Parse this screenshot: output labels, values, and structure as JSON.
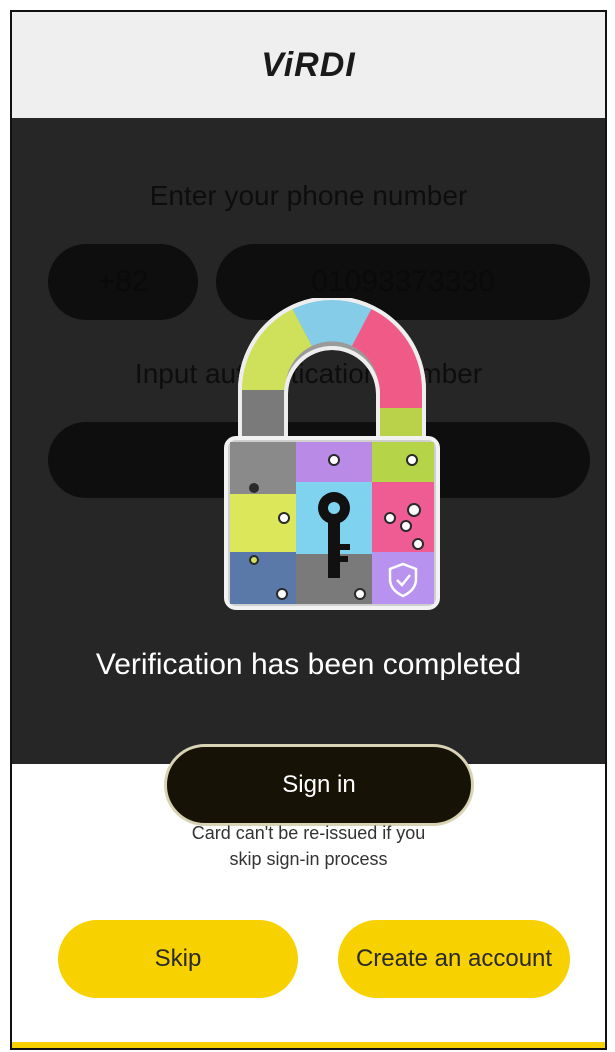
{
  "header": {
    "logo": "ViRDI"
  },
  "background_form": {
    "phone_label": "Enter your phone number",
    "country_code": "+82",
    "phone_number": "01093373330",
    "auth_label": "Input authentication number"
  },
  "dialog": {
    "message": "Verification has been completed",
    "signin_label": "Sign in"
  },
  "notice": {
    "line1": "Card can't be re-issued if you",
    "line2": "skip sign-in process"
  },
  "actions": {
    "skip_label": "Skip",
    "create_label": "Create an account"
  },
  "colors": {
    "accent_yellow": "#f7d100",
    "overlay_dark": "#262626",
    "header_bg": "#efefef"
  },
  "icons": [
    "padlock-puzzle-icon",
    "keyhole-icon",
    "shield-check-icon"
  ]
}
